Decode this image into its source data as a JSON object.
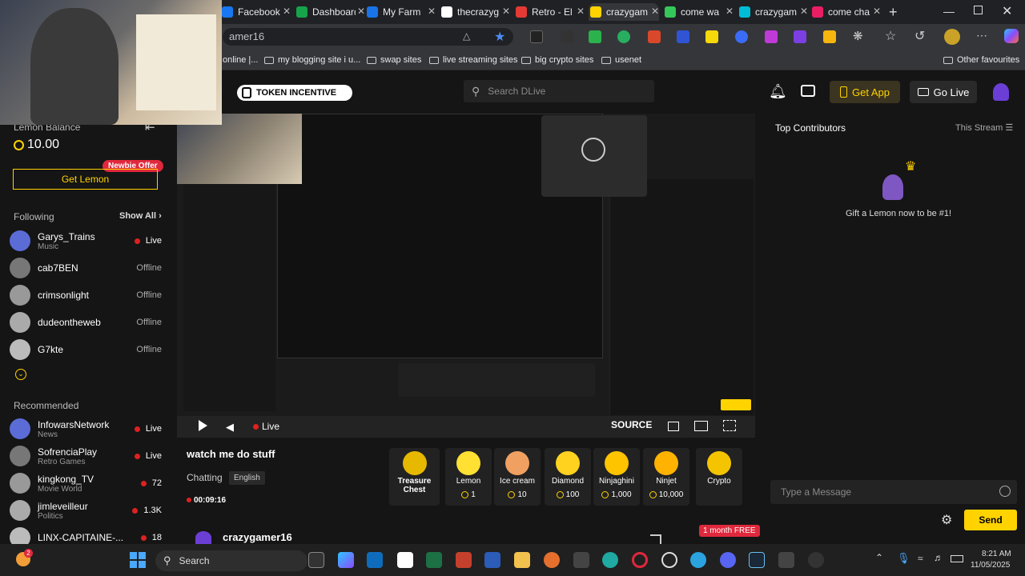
{
  "browser": {
    "tabs": [
      {
        "label": "Facebook",
        "color": "#1877f2"
      },
      {
        "label": "Dashboard",
        "color": "#16a34a"
      },
      {
        "label": "My Farm",
        "color": "#1a73e8"
      },
      {
        "label": "thecrazyg",
        "color": "#ffffff"
      },
      {
        "label": "Retro - El",
        "color": "#e53935"
      },
      {
        "label": "crazygam",
        "color": "#ffd300"
      },
      {
        "label": "come wa",
        "color": "#34c759"
      },
      {
        "label": "crazygam",
        "color": "#00bcd4"
      },
      {
        "label": "come cha",
        "color": "#e91e63"
      }
    ],
    "address": "amer16",
    "bookmarks": [
      {
        "label": "online |..."
      },
      {
        "label": "my blogging site i u..."
      },
      {
        "label": "swap sites"
      },
      {
        "label": "live streaming sites"
      },
      {
        "label": "big crypto sites"
      },
      {
        "label": "usenet"
      }
    ],
    "other_favourites": "Other favourites"
  },
  "header": {
    "logo_text": "TOKEN INCENTIVE",
    "search_placeholder": "Search DLive",
    "get_app": "Get App",
    "go_live": "Go Live"
  },
  "sidebar": {
    "lemon_balance_label": "Lemon Balance",
    "lemon_balance": "10.00",
    "get_lemon": "Get Lemon",
    "newbie_offer": "Newbie Offer",
    "following_label": "Following",
    "show_all": "Show All",
    "following": [
      {
        "name": "Garys_Trains",
        "sub": "Music",
        "status": "Live"
      },
      {
        "name": "cab7BEN",
        "sub": "",
        "status": "Offline"
      },
      {
        "name": "crimsonlight",
        "sub": "",
        "status": "Offline"
      },
      {
        "name": "dudeontheweb",
        "sub": "",
        "status": "Offline"
      },
      {
        "name": "G7kte",
        "sub": "",
        "status": "Offline"
      }
    ],
    "recommended_label": "Recommended",
    "recommended": [
      {
        "name": "InfowarsNetwork",
        "sub": "News",
        "status": "Live"
      },
      {
        "name": "SofrenciaPlay",
        "sub": "Retro Games",
        "status": "Live"
      },
      {
        "name": "kingkong_TV",
        "sub": "Movie World",
        "status": "72"
      },
      {
        "name": "jimleveilleur",
        "sub": "Politics",
        "status": "1.3K"
      },
      {
        "name": "LINX-CAPITAINE-...",
        "sub": "",
        "status": "18"
      }
    ]
  },
  "player": {
    "live_label": "Live",
    "source_label": "SOURCE"
  },
  "stream": {
    "title": "watch me do stuff",
    "category": "Chatting",
    "language": "English",
    "duration": "00:09:16",
    "streamer": "crazygamer16",
    "month_free": "1 month FREE"
  },
  "gifts": [
    {
      "name": "Treasure Chest",
      "price": "",
      "color": "#e6b800"
    },
    {
      "name": "Lemon",
      "price": "1",
      "color": "#ffe033"
    },
    {
      "name": "Ice cream",
      "price": "10",
      "color": "#f0a060"
    },
    {
      "name": "Diamond",
      "price": "100",
      "color": "#ffd21f"
    },
    {
      "name": "Ninjaghini",
      "price": "1,000",
      "color": "#ffc400"
    },
    {
      "name": "Ninjet",
      "price": "10,000",
      "color": "#ffb300"
    },
    {
      "name": "Crypto",
      "price": "",
      "color": "#f5c400"
    }
  ],
  "chat": {
    "top_contributors": "Top Contributors",
    "this_stream": "This Stream",
    "gift_prompt": "Gift a Lemon now to be #1!",
    "input_placeholder": "Type a Message",
    "send": "Send"
  },
  "taskbar": {
    "search": "Search",
    "time": "8:21 AM",
    "date": "11/05/2025",
    "notification_count": "2"
  }
}
